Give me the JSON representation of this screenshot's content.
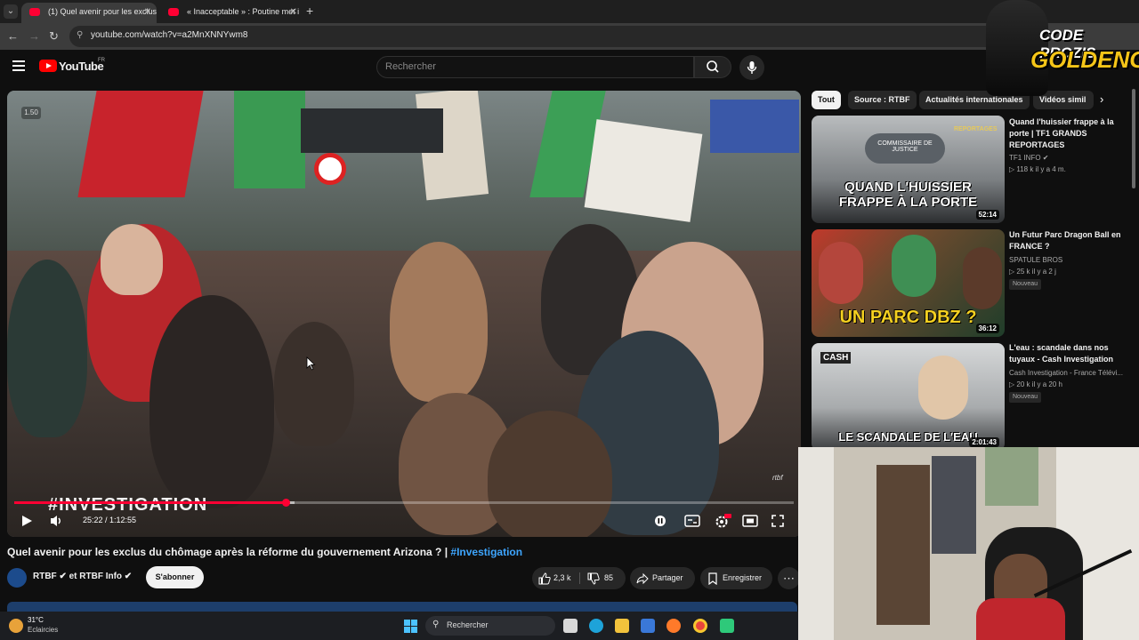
{
  "browser": {
    "tabs": [
      {
        "title": "(1) Quel avenir pour les exclus d"
      },
      {
        "title": "« Inacceptable » : Poutine met i"
      }
    ],
    "url": "youtube.com/watch?v=a2MnXNNYwm8"
  },
  "youtube": {
    "logo_text": "YouTube",
    "country_code": "FR",
    "search_placeholder": "Rechercher"
  },
  "player": {
    "speed_badge": "1.50",
    "overlay_title": "#INVESTIGATION",
    "watermark": "rtbf",
    "current_time": "25:22",
    "duration": "1:12:55",
    "time_display": "25:22 / 1:12:55",
    "progress_fraction": 0.348,
    "buffered_fraction": 0.36
  },
  "video": {
    "title": "Quel avenir pour les exclus du chômage après la réforme du gouvernement Arizona ? |",
    "hashtag": "#Investigation",
    "channel": "RTBF ✔ et RTBF Info ✔",
    "subscribe_label": "S'abonner",
    "likes": "2,3 k",
    "dislikes": "85",
    "share_label": "Partager",
    "save_label": "Enregistrer",
    "more_label": "⋯"
  },
  "sidebar": {
    "chips": [
      "Tout",
      "Source : RTBF",
      "Actualités internationales",
      "Vidéos simil"
    ],
    "recommendations": [
      {
        "title": "Quand l'huissier frappe à la porte | TF1 GRANDS REPORTAGES",
        "channel": "TF1 INFO ✔",
        "meta": "▷ 118 k  il y a 4 m.",
        "duration": "52:14",
        "thumb_text": "QUAND L'HUISSIER FRAPPE À LA PORTE",
        "thumb_sign": "COMMISSAIRE DE JUSTICE",
        "thumb_tag": "REPORTAGES",
        "badge": ""
      },
      {
        "title": "Un Futur Parc Dragon Ball en FRANCE ?",
        "channel": "SPATULE BROS",
        "meta": "▷ 25 k  il y a 2 j",
        "duration": "36:12",
        "thumb_text": "UN PARC DBZ ?",
        "badge": "Nouveau"
      },
      {
        "title": "L'eau : scandale dans nos tuyaux - Cash Investigation",
        "channel": "Cash Investigation - France Télévi...",
        "meta": "▷ 20 k  il y a 20 h",
        "duration": "2:01:43",
        "thumb_text": "LE SCANDALE DE L'EAU",
        "thumb_tag": "CASH",
        "badge": "Nouveau"
      }
    ]
  },
  "overlay": {
    "line1": "CODE PROZIS",
    "line2": "GOLDENG"
  },
  "taskbar": {
    "temperature": "31°C",
    "weather": "Eclaircies",
    "search_label": "Rechercher"
  },
  "colors": {
    "accent_red": "#ff0033",
    "link_blue": "#3ea6ff",
    "background": "#0f0f0f"
  }
}
